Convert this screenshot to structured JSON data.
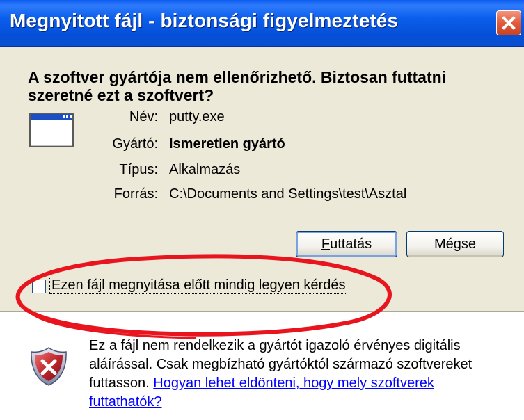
{
  "window": {
    "title": "Megnyitott fájl - biztonsági figyelmeztetés",
    "close_icon": "close-icon"
  },
  "dialog": {
    "headline": "A szoftver gyártója nem ellenőrizhető. Biztosan futtatni szeretné ezt a szoftvert?",
    "fields": {
      "name_label": "Név:",
      "name_value": "putty.exe",
      "publisher_label": "Gyártó:",
      "publisher_value": "Ismeretlen gyártó",
      "type_label": "Típus:",
      "type_value": "Alkalmazás",
      "source_label": "Forrás:",
      "source_value": "C:\\Documents and Settings\\test\\Asztal"
    },
    "buttons": {
      "run": "Futtatás",
      "cancel": "Mégse"
    },
    "checkbox": {
      "label": "Ezen fájl megnyitása előtt mindig legyen kérdés",
      "checked": false
    },
    "info": {
      "text": "Ez a fájl nem rendelkezik a gyártót igazoló érvényes digitális aláírással. Csak megbízható gyártóktól származó szoftvereket futtasson.",
      "link": "Hogyan lehet eldönteni, hogy mely szoftverek futtathatók?"
    }
  },
  "colors": {
    "titlebar": "#0A5BEF",
    "dialog_bg": "#ECE9D8",
    "annotation": "#E8141E",
    "link": "#0000FF",
    "shield": "#C0282E"
  }
}
